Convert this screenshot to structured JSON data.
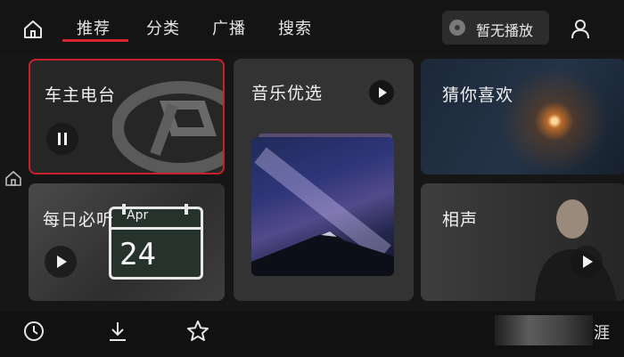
{
  "tabs": [
    {
      "label": "推荐",
      "active": true
    },
    {
      "label": "分类",
      "active": false
    },
    {
      "label": "广播",
      "active": false
    },
    {
      "label": "搜索",
      "active": false
    }
  ],
  "now_playing": {
    "label": "暂无播放"
  },
  "cards": {
    "owner_radio": {
      "title": "车主电台",
      "state": "playing",
      "icon": "pause-icon"
    },
    "daily_listen": {
      "title": "每日必听",
      "calendar_month": "Apr",
      "calendar_day": "24",
      "icon": "play-icon"
    },
    "music_pick": {
      "title": "音乐优选",
      "icon": "play-icon"
    },
    "guess_like": {
      "title": "猜你喜欢"
    },
    "crosstalk": {
      "title": "相声",
      "icon": "play-icon"
    }
  },
  "bottom_bar": {
    "icons": [
      "history-icon",
      "download-icon",
      "star-icon"
    ],
    "corner_text": "涯"
  },
  "colors": {
    "accent": "#d7232f",
    "background": "#161616",
    "card": "#2a2a2a"
  }
}
